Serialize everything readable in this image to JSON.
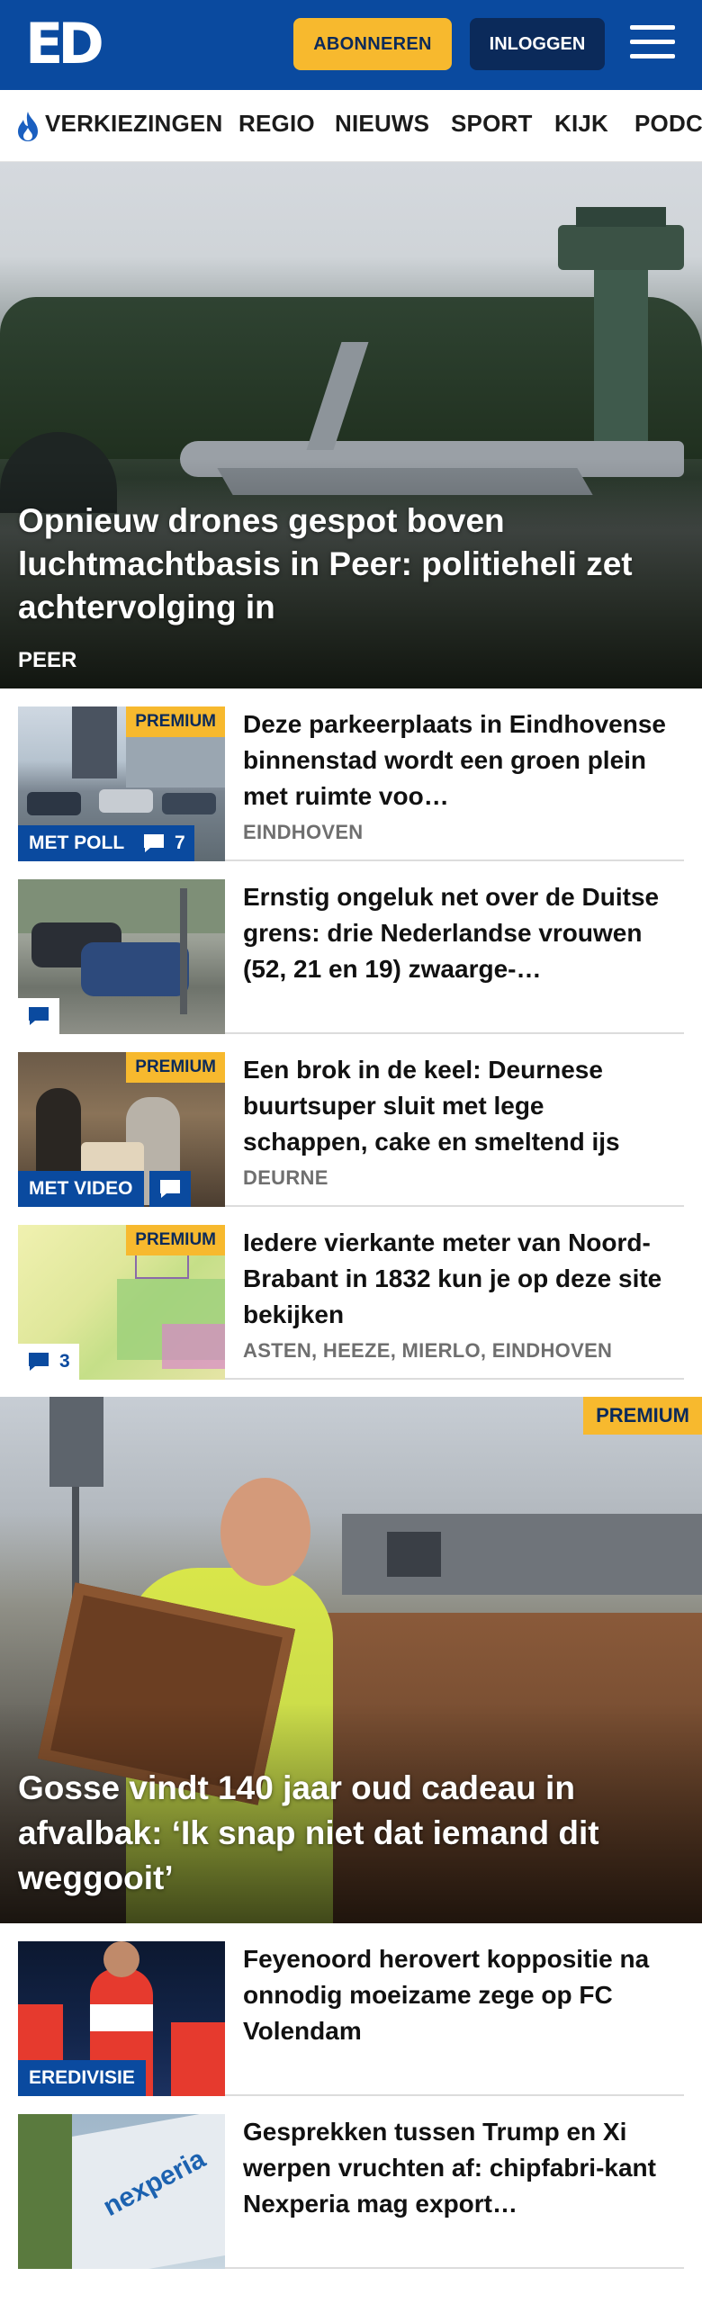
{
  "header": {
    "logo": "ED",
    "subscribe_label": "ABONNEREN",
    "login_label": "INLOGGEN"
  },
  "nav": {
    "items": [
      "VERKIEZINGEN",
      "REGIO",
      "NIEUWS",
      "SPORT",
      "KIJK",
      "PODC"
    ]
  },
  "hero": {
    "title": "Opnieuw drones gespot boven luchtmachtbasis in Peer: politieheli zet achtervolging in",
    "location": "PEER"
  },
  "articles": [
    {
      "title": "Deze parkeerplaats in Eindhovense binnenstad wordt een groen plein met ruimte voo…",
      "location": "EINDHOVEN",
      "premium": "PREMIUM",
      "badge": "MET POLL",
      "comments": "7"
    },
    {
      "title": "Ernstig ongeluk net over de Duitse grens: drie Nederlandse vrouwen (52, 21 en 19) zwaarge-…",
      "location": "",
      "premium": "",
      "badge": "",
      "comments": ""
    },
    {
      "title": "Een brok in de keel: Deurnese buurtsuper sluit met lege schappen, cake en smeltend ijs",
      "location": "DEURNE",
      "premium": "PREMIUM",
      "badge": "MET VIDEO",
      "comments": ""
    },
    {
      "title": "Iedere vierkante meter van Noord-Brabant in 1832 kun je op deze site bekijken",
      "location": "ASTEN, HEEZE, MIERLO, EINDHOVEN",
      "premium": "PREMIUM",
      "badge": "",
      "comments": "3"
    }
  ],
  "feature": {
    "premium": "PREMIUM",
    "title": "Gosse vindt 140 jaar oud cadeau in afvalbak: ‘Ik snap niet dat iemand dit weggooit’"
  },
  "articles2": [
    {
      "title": "Feyenoord herovert koppositie na onnodig moeizame zege op FC Volendam",
      "badge": "EREDIVISIE"
    },
    {
      "title": "Gesprekken tussen Trump en Xi werpen vruchten af: chipfabri-kant Nexperia mag export…",
      "brand": "nexperia"
    }
  ],
  "colors": {
    "brand_blue": "#0a4a9f",
    "premium_yellow": "#f7b92e",
    "dark_navy": "#0b2a5a"
  }
}
